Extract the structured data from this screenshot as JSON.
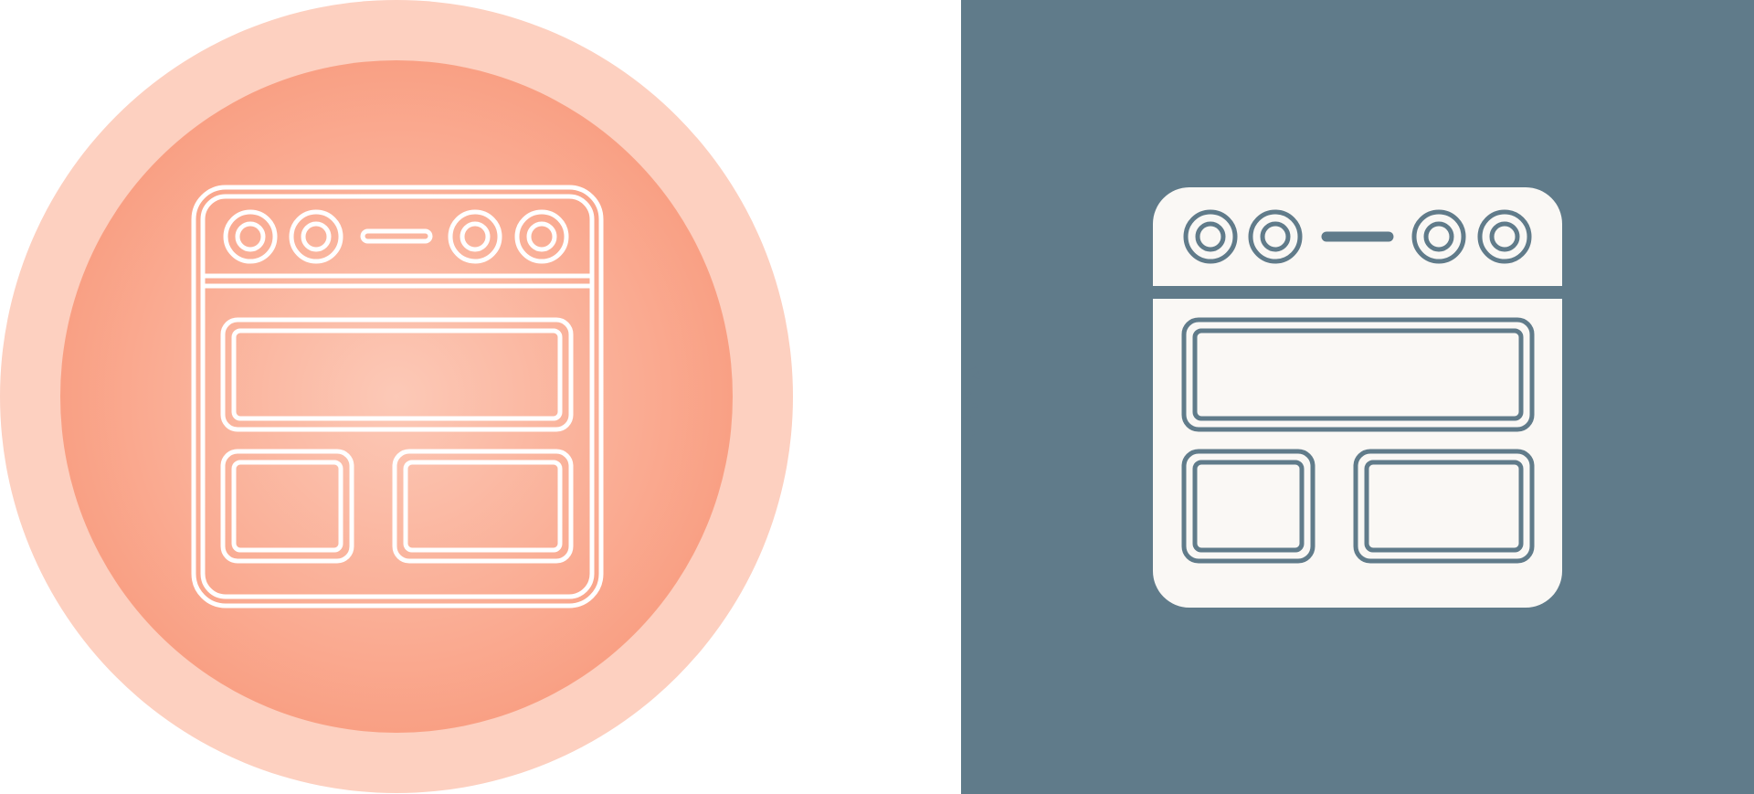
{
  "icons": [
    {
      "name": "browser-layout-icon",
      "style": "outline",
      "background_shape": "circle",
      "colors": {
        "outer_ring": "#fdd0c0",
        "inner_fill_center": "#fcc9b7",
        "inner_fill_edge": "#f9a084",
        "stroke": "#ffffff"
      }
    },
    {
      "name": "browser-layout-icon",
      "style": "glyph",
      "background_shape": "square",
      "colors": {
        "background": "#607b8a",
        "glyph": "#faf8f5",
        "detail": "#607b8a"
      }
    }
  ]
}
